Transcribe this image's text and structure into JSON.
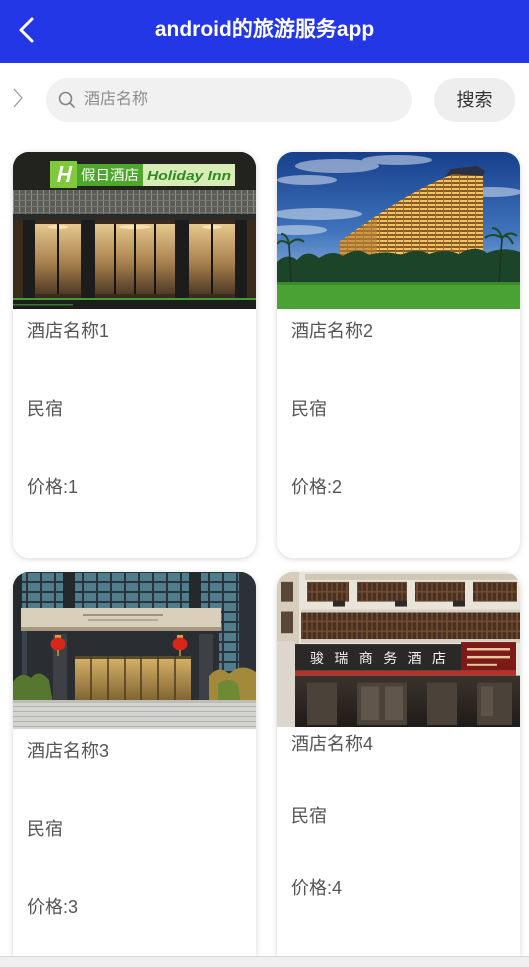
{
  "colors": {
    "header_bg": "#2437e6",
    "header_text": "#ffffff",
    "input_bg": "#f1f1f1",
    "button_bg": "#eeeeee",
    "card_text": "#555555"
  },
  "header": {
    "back_icon": "chevron-left-icon",
    "title": "android的旅游服务app"
  },
  "search": {
    "toggle_icon": "chevron-right-icon",
    "search_icon": "search-icon",
    "value": "",
    "placeholder": "酒店名称",
    "button_label": "搜索"
  },
  "hotels": [
    {
      "name": "酒店名称1",
      "category": "民宿",
      "price": "价格:1",
      "photo_sign": [
        "假日酒店",
        "Holiday Inn"
      ]
    },
    {
      "name": "酒店名称2",
      "category": "民宿",
      "price": "价格:2"
    },
    {
      "name": "酒店名称3",
      "category": "民宿",
      "price": "价格:3"
    },
    {
      "name": "酒店名称4",
      "category": "民宿",
      "price": "价格:4",
      "photo_sign": [
        "骏瑞商务酒店"
      ]
    }
  ]
}
